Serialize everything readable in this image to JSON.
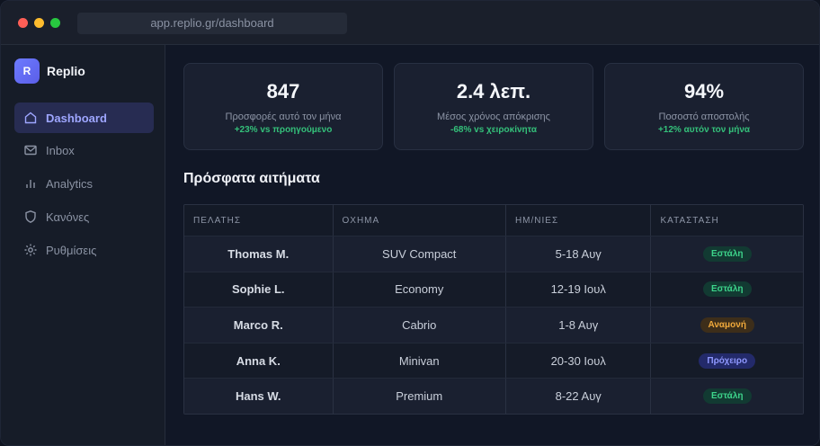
{
  "browser": {
    "url": "app.replio.gr/dashboard"
  },
  "brand": {
    "logo_letter": "R",
    "name": "Replio"
  },
  "nav": [
    {
      "label": "Dashboard",
      "icon": "home-icon",
      "active": true
    },
    {
      "label": "Inbox",
      "icon": "mail-icon",
      "active": false
    },
    {
      "label": "Analytics",
      "icon": "bar-chart-icon",
      "active": false
    },
    {
      "label": "Κανόνες",
      "icon": "shield-icon",
      "active": false
    },
    {
      "label": "Ρυθμίσεις",
      "icon": "gear-icon",
      "active": false
    }
  ],
  "stats": [
    {
      "value": "847",
      "label": "Προσφορές αυτό τον μήνα",
      "delta": "+23% vs προηγούμενο"
    },
    {
      "value": "2.4 λεπ.",
      "label": "Μέσος χρόνος απόκρισης",
      "delta": "-68% vs χειροκίνητα"
    },
    {
      "value": "94%",
      "label": "Ποσοστό αποστολής",
      "delta": "+12% αυτόν τον μήνα"
    }
  ],
  "section_title": "Πρόσφατα αιτήματα",
  "table": {
    "headers": [
      "ΠΕΛΑΤΗΣ",
      "ΟΧΗΜΑ",
      "ΗΜ/ΝΙΕΣ",
      "ΚΑΤΑΣΤΑΣΗ"
    ],
    "rows": [
      {
        "customer": "Thomas M.",
        "vehicle": "SUV Compact",
        "dates": "5-18 Αυγ",
        "status": "Εστάλη"
      },
      {
        "customer": "Sophie L.",
        "vehicle": "Economy",
        "dates": "12-19 Ιουλ",
        "status": "Εστάλη"
      },
      {
        "customer": "Marco R.",
        "vehicle": "Cabrio",
        "dates": "1-8 Αυγ",
        "status": "Αναμονή"
      },
      {
        "customer": "Anna K.",
        "vehicle": "Minivan",
        "dates": "20-30 Ιουλ",
        "status": "Πρόχειρο"
      },
      {
        "customer": "Hans W.",
        "vehicle": "Premium",
        "dates": "8-22 Αυγ",
        "status": "Εστάλη"
      }
    ]
  },
  "colors": {
    "accent": "#6d7bff",
    "sent": "#3dd48b",
    "pending": "#f0a93b",
    "draft": "#8f98ff",
    "positive": "#34c07a"
  }
}
